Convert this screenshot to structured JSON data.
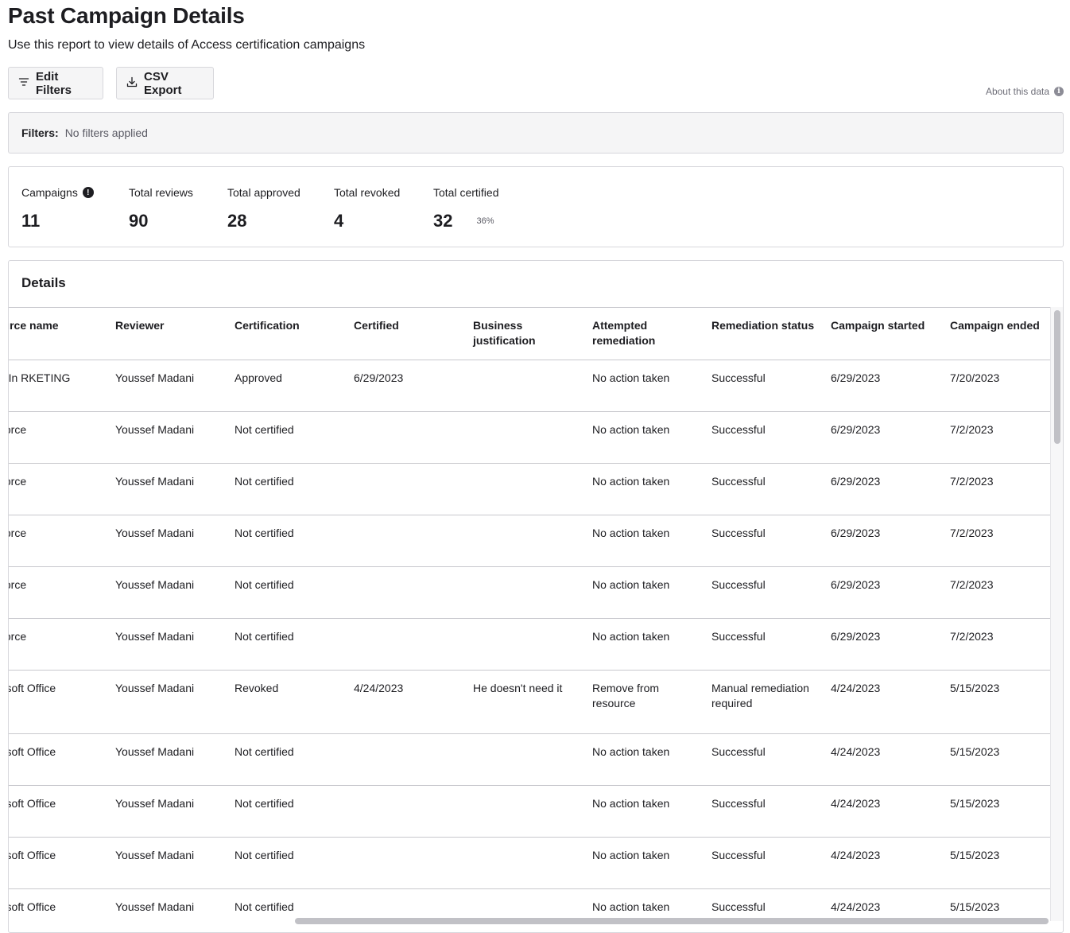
{
  "header": {
    "title": "Past Campaign Details",
    "subtitle": "Use this report to view details of Access certification campaigns"
  },
  "toolbar": {
    "edit_filters_label": "Edit Filters",
    "csv_export_label": "CSV Export",
    "about_label": "About this data"
  },
  "filters": {
    "label": "Filters:",
    "value": "No filters applied"
  },
  "stats": {
    "campaigns_label": "Campaigns",
    "campaigns_value": "11",
    "total_reviews_label": "Total reviews",
    "total_reviews_value": "90",
    "total_approved_label": "Total approved",
    "total_approved_value": "28",
    "total_revoked_label": "Total revoked",
    "total_revoked_value": "4",
    "total_certified_label": "Total certified",
    "total_certified_value": "32",
    "total_certified_pct": "36%"
  },
  "details": {
    "title": "Details",
    "columns": [
      "ource name",
      "Reviewer",
      "Certification",
      "Certified",
      "Business justification",
      "Attempted remediation",
      "Remediation status",
      "Campaign started",
      "Campaign ended"
    ],
    "rows": [
      [
        "edIn RKETING",
        "Youssef Madani",
        "Approved",
        "6/29/2023",
        "",
        "No action taken",
        "Successful",
        "6/29/2023",
        "7/20/2023"
      ],
      [
        "sforce",
        "Youssef Madani",
        "Not certified",
        "",
        "",
        "No action taken",
        "Successful",
        "6/29/2023",
        "7/2/2023"
      ],
      [
        "sforce",
        "Youssef Madani",
        "Not certified",
        "",
        "",
        "No action taken",
        "Successful",
        "6/29/2023",
        "7/2/2023"
      ],
      [
        "sforce",
        "Youssef Madani",
        "Not certified",
        "",
        "",
        "No action taken",
        "Successful",
        "6/29/2023",
        "7/2/2023"
      ],
      [
        "sforce",
        "Youssef Madani",
        "Not certified",
        "",
        "",
        "No action taken",
        "Successful",
        "6/29/2023",
        "7/2/2023"
      ],
      [
        "sforce",
        "Youssef Madani",
        "Not certified",
        "",
        "",
        "No action taken",
        "Successful",
        "6/29/2023",
        "7/2/2023"
      ],
      [
        "rosoft Office",
        "Youssef Madani",
        "Revoked",
        "4/24/2023",
        "He doesn't need it",
        "Remove from resource",
        "Manual remediation required",
        "4/24/2023",
        "5/15/2023"
      ],
      [
        "rosoft Office",
        "Youssef Madani",
        "Not certified",
        "",
        "",
        "No action taken",
        "Successful",
        "4/24/2023",
        "5/15/2023"
      ],
      [
        "rosoft Office",
        "Youssef Madani",
        "Not certified",
        "",
        "",
        "No action taken",
        "Successful",
        "4/24/2023",
        "5/15/2023"
      ],
      [
        "rosoft Office",
        "Youssef Madani",
        "Not certified",
        "",
        "",
        "No action taken",
        "Successful",
        "4/24/2023",
        "5/15/2023"
      ],
      [
        "rosoft Office",
        "Youssef Madani",
        "Not certified",
        "",
        "",
        "No action taken",
        "Successful",
        "4/24/2023",
        "5/15/2023"
      ]
    ]
  }
}
